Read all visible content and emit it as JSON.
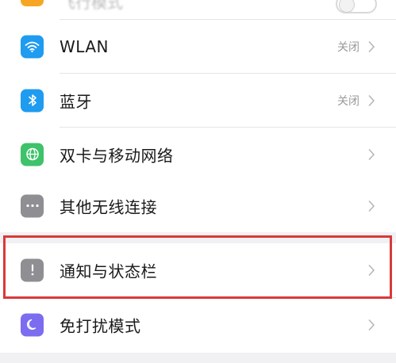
{
  "settings": {
    "top_partial": {
      "label": "飞行模式",
      "icon": "airplane-icon"
    },
    "items": [
      {
        "label": "WLAN",
        "value": "关闭",
        "icon": "wifi-icon",
        "color": "#1f9bf0"
      },
      {
        "label": "蓝牙",
        "value": "关闭",
        "icon": "bluetooth-icon",
        "color": "#1f9bf0"
      },
      {
        "label": "双卡与移动网络",
        "value": "",
        "icon": "globe-icon",
        "color": "#3ec26a"
      },
      {
        "label": "其他无线连接",
        "value": "",
        "icon": "more-icon",
        "color": "#8e8e93"
      },
      {
        "label": "通知与状态栏",
        "value": "",
        "icon": "notification-icon",
        "color": "#8e8e93"
      },
      {
        "label": "免打扰模式",
        "value": "",
        "icon": "moon-icon",
        "color": "#7b6cf0"
      }
    ]
  },
  "colors": {
    "highlight": "#d9393a",
    "background": "#f1f1f3"
  }
}
